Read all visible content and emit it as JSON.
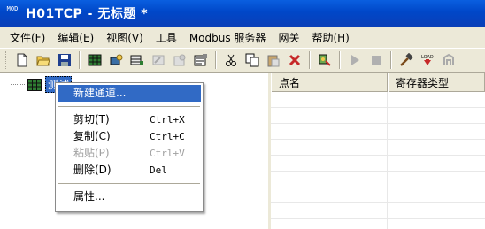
{
  "window": {
    "title": "H01TCP - 无标题 *",
    "icon_text": "MOD"
  },
  "menubar": {
    "items": [
      "文件(F)",
      "编辑(E)",
      "视图(V)",
      "工具",
      "Modbus 服务器",
      "网关",
      "帮助(H)"
    ]
  },
  "toolbar": {
    "buttons": [
      "new",
      "open",
      "save",
      "add-channel",
      "add-device",
      "add-tag",
      "properties-disabled",
      "properties",
      "cut",
      "copy",
      "paste",
      "delete",
      "connect",
      "run",
      "stop",
      "tools",
      "load",
      "gateway"
    ]
  },
  "tree": {
    "root_label": "测试"
  },
  "grid": {
    "columns": [
      "点名",
      "寄存器类型"
    ]
  },
  "context_menu": {
    "items": [
      {
        "label": "新建通道...",
        "shortcut": "",
        "state": "selected"
      },
      {
        "label": "剪切(T)",
        "shortcut": "Ctrl+X",
        "state": "normal"
      },
      {
        "label": "复制(C)",
        "shortcut": "Ctrl+C",
        "state": "normal"
      },
      {
        "label": "粘贴(P)",
        "shortcut": "Ctrl+V",
        "state": "disabled"
      },
      {
        "label": "删除(D)",
        "shortcut": "Del",
        "state": "normal"
      },
      {
        "label": "属性...",
        "shortcut": "",
        "state": "normal"
      }
    ]
  },
  "colors": {
    "titlebar": "#0054e3",
    "selection": "#316ac5",
    "chrome": "#ece9d8"
  }
}
